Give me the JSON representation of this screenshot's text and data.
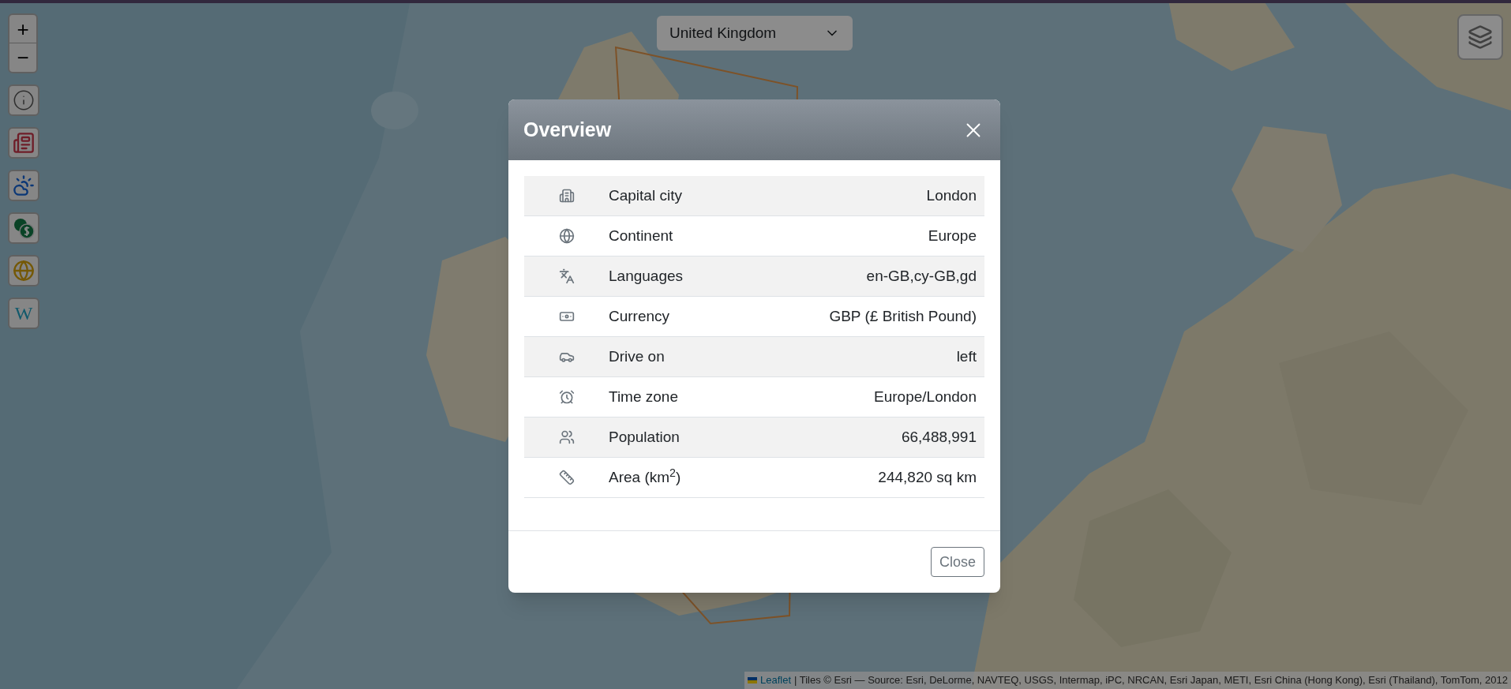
{
  "country_select": {
    "value": "United Kingdom"
  },
  "zoom": {
    "in": "+",
    "out": "−"
  },
  "toolbar": [
    {
      "kind": "info"
    },
    {
      "kind": "news"
    },
    {
      "kind": "weather"
    },
    {
      "kind": "currency"
    },
    {
      "kind": "globe"
    },
    {
      "kind": "wiki",
      "label": "W"
    }
  ],
  "attribution": {
    "link": "Leaflet",
    "text": "| Tiles © Esri — Source: Esri, DeLorme, NAVTEQ, USGS, Intermap, iPC, NRCAN, Esri Japan, METI, Esri China (Hong Kong), Esri (Thailand), TomTom, 2012"
  },
  "modal": {
    "title": "Overview",
    "rows": [
      {
        "kind": "capital",
        "label": "Capital city",
        "value": "London"
      },
      {
        "kind": "continent",
        "label": "Continent",
        "value": "Europe"
      },
      {
        "kind": "languages",
        "label": "Languages",
        "value": "en-GB,cy-GB,gd"
      },
      {
        "kind": "currency",
        "label": "Currency",
        "value": "GBP (£ British Pound)"
      },
      {
        "kind": "drive",
        "label": "Drive on",
        "value": "left"
      },
      {
        "kind": "timezone",
        "label": "Time zone",
        "value": "Europe/London"
      },
      {
        "kind": "population",
        "label": "Population",
        "value": "66,488,991"
      },
      {
        "kind": "area",
        "label": "Area (km$^{2}$)",
        "value": "244,820 sq km"
      }
    ],
    "close_button": "Close"
  }
}
